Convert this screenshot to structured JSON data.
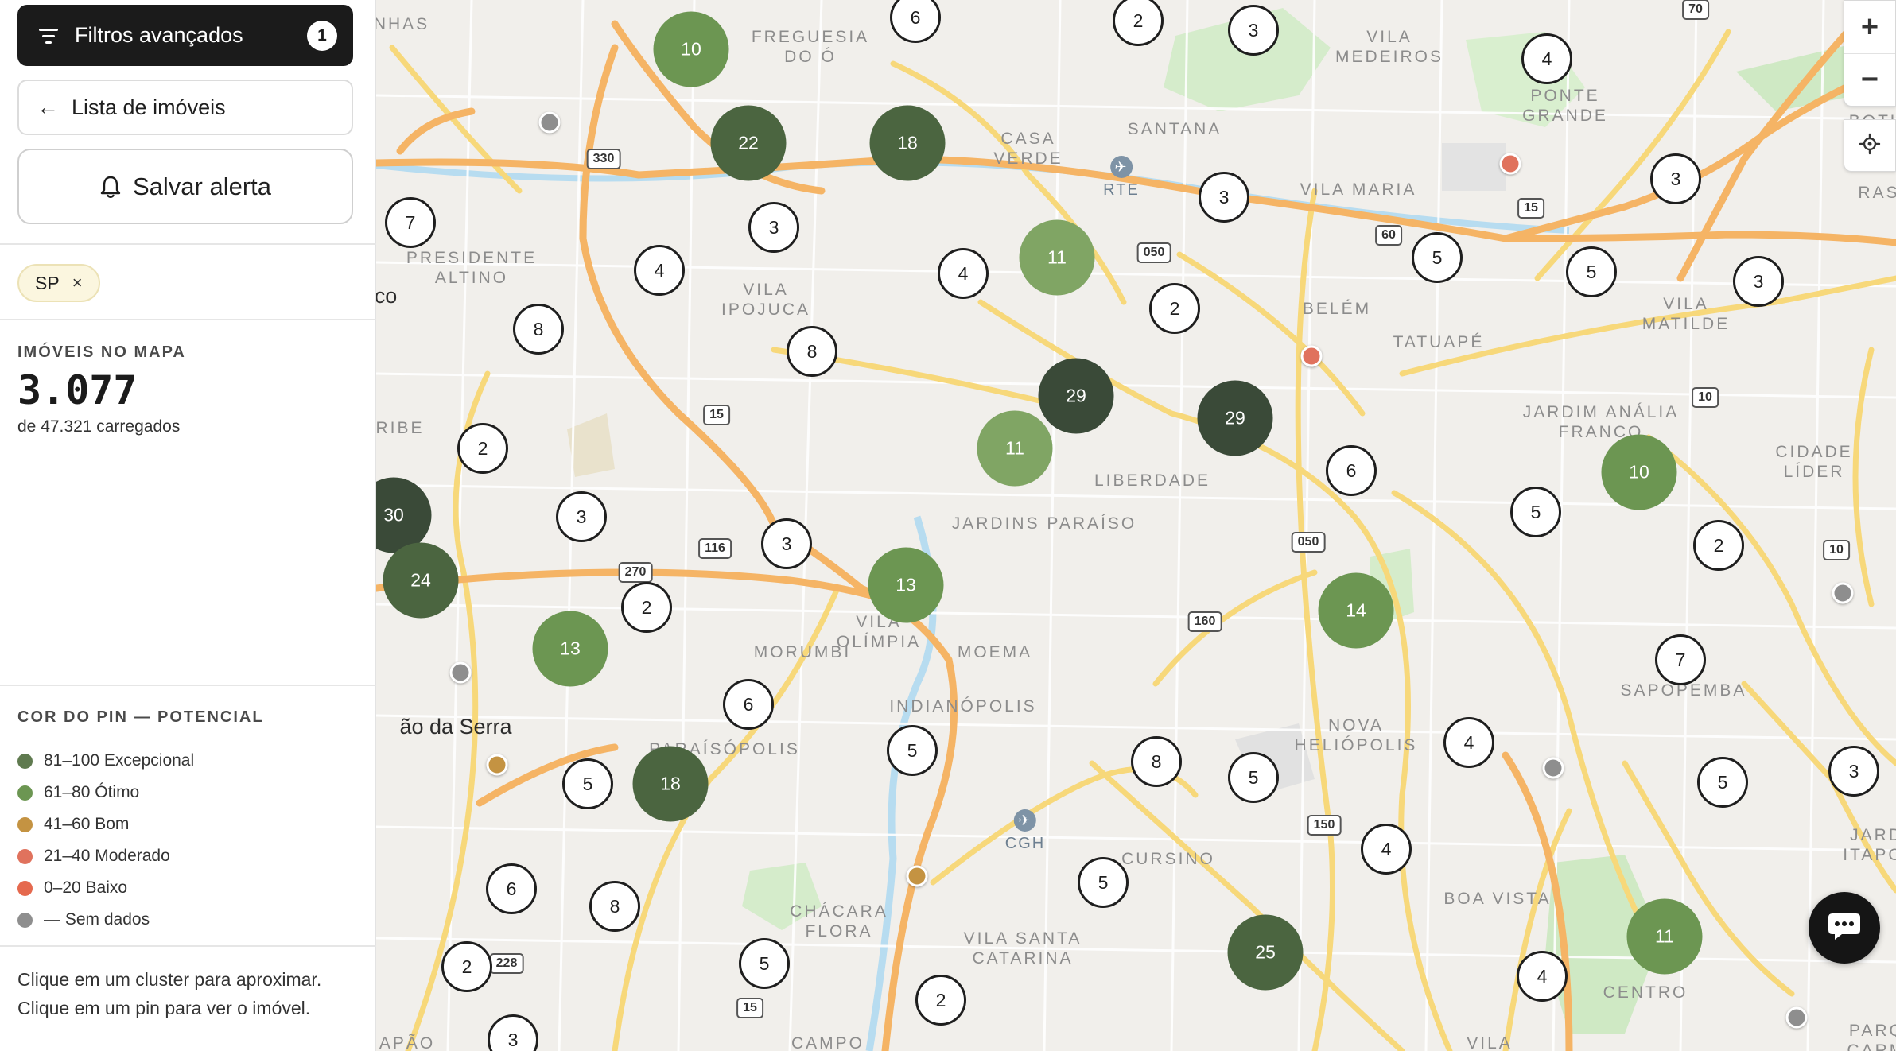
{
  "sidebar": {
    "filters_label": "Filtros avançados",
    "filters_count": "1",
    "list_label": "Lista de imóveis",
    "alert_label": "Salvar alerta",
    "chip_label": "SP",
    "chip_close": "×",
    "map_count_label": "IMÓVEIS NO MAPA",
    "map_count_value": "3.077",
    "loaded_text": "de 47.321 carregados",
    "legend_title": "COR DO PIN — POTENCIAL",
    "legend": [
      {
        "label": "81–100 Excepcional",
        "color": "#5f7a4f"
      },
      {
        "label": "61–80 Ótimo",
        "color": "#6c9652"
      },
      {
        "label": "41–60 Bom",
        "color": "#c49342"
      },
      {
        "label": "21–40 Moderado",
        "color": "#e0725d"
      },
      {
        "label": "0–20 Baixo",
        "color": "#e5694e"
      },
      {
        "label": "— Sem dados",
        "color": "#8e8e8e"
      }
    ],
    "help_text": "Clique em um cluster para aproximar. Clique em um pin para ver o imóvel."
  },
  "map": {
    "colors": {
      "exceptional": "#4b6540",
      "great": "#6c9652",
      "good": "#80a564",
      "darkest": "#3a4a38"
    },
    "places": [
      {
        "text": "FREGUESIA\nDO Ó"
      },
      {
        "text": "VILA\nMEDEIROS"
      },
      {
        "text": "CASA\nVERDE"
      },
      {
        "text": "SANTANA"
      },
      {
        "text": "PONTE\nGRANDE"
      },
      {
        "text": "VILA MARIA"
      },
      {
        "text": "PRESIDENTE\nALTINO"
      },
      {
        "text": "VILA\nIPOJUCA"
      },
      {
        "text": "BELÉM"
      },
      {
        "text": "TATUAPÉ"
      },
      {
        "text": "VILA\nMATILDE"
      },
      {
        "text": "JARDIM ANÁLIA\nFRANCO"
      },
      {
        "text": "RIBE"
      },
      {
        "text": "LIBERDADE"
      },
      {
        "text": "JARDINS  PARAÍSO"
      },
      {
        "text": "CIDADE\nLÍDER"
      },
      {
        "text": "MORUMBI"
      },
      {
        "text": "VILA\nOLÍMPIA"
      },
      {
        "text": "MOEMA"
      },
      {
        "text": "INDIANÓPOLIS"
      },
      {
        "text": "SAPOPEMBA"
      },
      {
        "text": "NOVA\nHELIÓPOLIS"
      },
      {
        "text": "PARAÍSÓPOLIS"
      },
      {
        "text": "CURSINO"
      },
      {
        "text": "BOA VISTA"
      },
      {
        "text": "JARDI\nITAPOA"
      },
      {
        "text": "CHÁCARA\nFLORA"
      },
      {
        "text": "VILA SANTA\nCATARINA"
      },
      {
        "text": "CENTRO"
      },
      {
        "text": "CAMPO"
      },
      {
        "text": "CAPÃO"
      },
      {
        "text": "BOTUR"
      },
      {
        "text": "RASA"
      },
      {
        "text": "PARQU\nCARMO"
      },
      {
        "text": "VILA"
      },
      {
        "text": "NHAS"
      }
    ],
    "dark_places": [
      {
        "text": "ão da Serra"
      },
      {
        "text": "co"
      }
    ],
    "shields": [
      "330",
      "050",
      "60",
      "15",
      "70",
      "15",
      "10",
      "116",
      "270",
      "050",
      "160",
      "10",
      "150",
      "228",
      "15"
    ],
    "airports": [
      {
        "text": "RTE"
      },
      {
        "text": "CGH"
      }
    ],
    "clusters": [
      {
        "n": "10",
        "style": "filled",
        "tone": "great"
      },
      {
        "n": "22",
        "style": "filled",
        "tone": "exceptional"
      },
      {
        "n": "18",
        "style": "filled",
        "tone": "exceptional"
      },
      {
        "n": "6",
        "style": "outline"
      },
      {
        "n": "2",
        "style": "outline"
      },
      {
        "n": "3",
        "style": "outline"
      },
      {
        "n": "4",
        "style": "outline"
      },
      {
        "n": "7",
        "style": "outline"
      },
      {
        "n": "3",
        "style": "outline"
      },
      {
        "n": "4",
        "style": "outline"
      },
      {
        "n": "4",
        "style": "outline"
      },
      {
        "n": "11",
        "style": "filled",
        "tone": "good"
      },
      {
        "n": "3",
        "style": "outline"
      },
      {
        "n": "2",
        "style": "outline"
      },
      {
        "n": "5",
        "style": "outline"
      },
      {
        "n": "5",
        "style": "outline"
      },
      {
        "n": "3",
        "style": "outline"
      },
      {
        "n": "3",
        "style": "outline"
      },
      {
        "n": "8",
        "style": "outline"
      },
      {
        "n": "8",
        "style": "outline"
      },
      {
        "n": "29",
        "style": "filled",
        "tone": "darkest"
      },
      {
        "n": "29",
        "style": "filled",
        "tone": "darkest"
      },
      {
        "n": "11",
        "style": "filled",
        "tone": "good"
      },
      {
        "n": "2",
        "style": "outline"
      },
      {
        "n": "6",
        "style": "outline"
      },
      {
        "n": "10",
        "style": "filled",
        "tone": "great"
      },
      {
        "n": "30",
        "style": "filled",
        "tone": "darkest"
      },
      {
        "n": "3",
        "style": "outline"
      },
      {
        "n": "3",
        "style": "outline"
      },
      {
        "n": "5",
        "style": "outline"
      },
      {
        "n": "2",
        "style": "outline"
      },
      {
        "n": "24",
        "style": "filled",
        "tone": "exceptional"
      },
      {
        "n": "13",
        "style": "filled",
        "tone": "great"
      },
      {
        "n": "2",
        "style": "outline"
      },
      {
        "n": "13",
        "style": "filled",
        "tone": "great"
      },
      {
        "n": "14",
        "style": "filled",
        "tone": "great"
      },
      {
        "n": "7",
        "style": "outline"
      },
      {
        "n": "6",
        "style": "outline"
      },
      {
        "n": "5",
        "style": "outline"
      },
      {
        "n": "18",
        "style": "filled",
        "tone": "exceptional"
      },
      {
        "n": "5",
        "style": "outline"
      },
      {
        "n": "8",
        "style": "outline"
      },
      {
        "n": "5",
        "style": "outline"
      },
      {
        "n": "4",
        "style": "outline"
      },
      {
        "n": "5",
        "style": "outline"
      },
      {
        "n": "3",
        "style": "outline"
      },
      {
        "n": "6",
        "style": "outline"
      },
      {
        "n": "8",
        "style": "outline"
      },
      {
        "n": "5",
        "style": "outline"
      },
      {
        "n": "4",
        "style": "outline"
      },
      {
        "n": "2",
        "style": "outline"
      },
      {
        "n": "5",
        "style": "outline"
      },
      {
        "n": "25",
        "style": "filled",
        "tone": "exceptional"
      },
      {
        "n": "11",
        "style": "filled",
        "tone": "great"
      },
      {
        "n": "2",
        "style": "outline"
      },
      {
        "n": "4",
        "style": "outline"
      },
      {
        "n": "3",
        "style": "outline"
      }
    ],
    "pins": [
      {
        "category": "Sem dados",
        "color": "#8e8e8e"
      },
      {
        "category": "Moderado",
        "color": "#e0725d"
      },
      {
        "category": "Moderado",
        "color": "#e0725d"
      },
      {
        "category": "Sem dados",
        "color": "#8e8e8e"
      },
      {
        "category": "Sem dados",
        "color": "#8e8e8e"
      },
      {
        "category": "Bom",
        "color": "#c49342"
      },
      {
        "category": "Sem dados",
        "color": "#8e8e8e"
      },
      {
        "category": "Bom",
        "color": "#c49342"
      },
      {
        "category": "Sem dados",
        "color": "#8e8e8e"
      }
    ],
    "controls": {
      "zoom_in": "+",
      "zoom_out": "−"
    }
  }
}
